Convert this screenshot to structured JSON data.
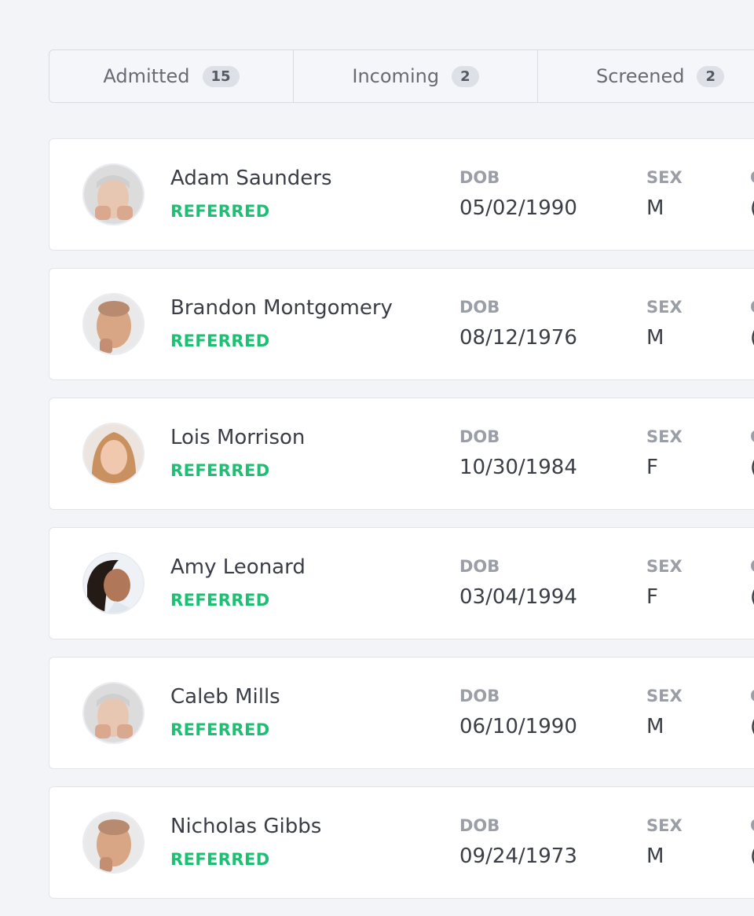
{
  "tabs": [
    {
      "label": "Admitted",
      "count": "15"
    },
    {
      "label": "Incoming",
      "count": "2"
    },
    {
      "label": "Screened",
      "count": "2"
    }
  ],
  "fields": {
    "dob_label": "DOB",
    "sex_label": "SEX",
    "third_label": "C",
    "third_value": "("
  },
  "patients": [
    {
      "name": "Adam Saunders",
      "status": "REFERRED",
      "dob": "05/02/1990",
      "sex": "M"
    },
    {
      "name": "Brandon Montgomery",
      "status": "REFERRED",
      "dob": "08/12/1976",
      "sex": "M"
    },
    {
      "name": "Lois Morrison",
      "status": "REFERRED",
      "dob": "10/30/1984",
      "sex": "F"
    },
    {
      "name": "Amy Leonard",
      "status": "REFERRED",
      "dob": "03/04/1994",
      "sex": "F"
    },
    {
      "name": "Caleb Mills",
      "status": "REFERRED",
      "dob": "06/10/1990",
      "sex": "M"
    },
    {
      "name": "Nicholas Gibbs",
      "status": "REFERRED",
      "dob": "09/24/1973",
      "sex": "M"
    }
  ],
  "colors": {
    "status_referred": "#1dbf73",
    "background": "#f3f4f7",
    "card": "#ffffff"
  }
}
